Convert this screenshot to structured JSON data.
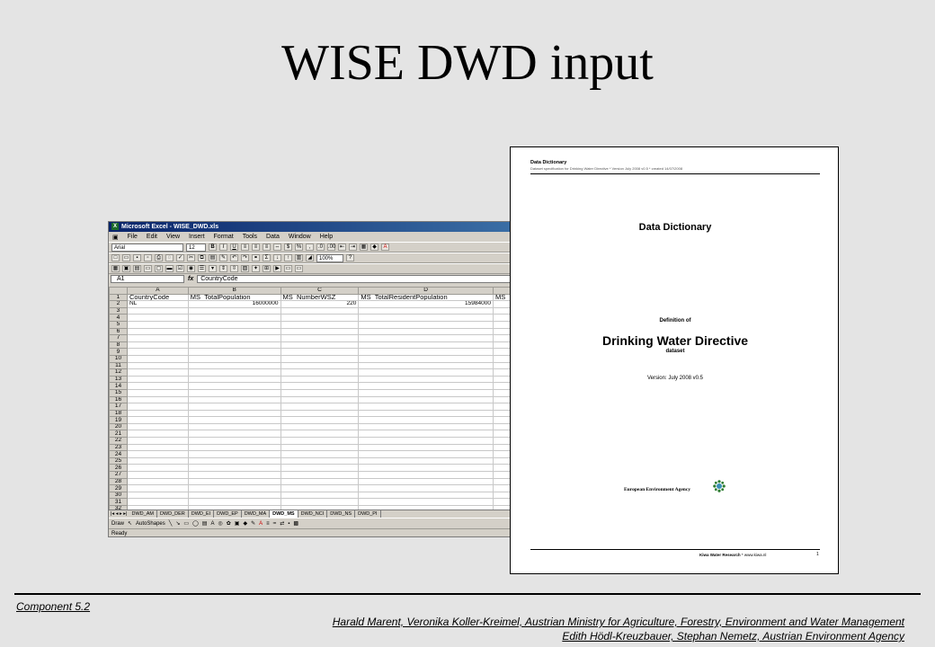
{
  "slide": {
    "title": "WISE DWD input",
    "component": "Component  5.2",
    "authors_line1": "Harald  Marent, Veronika Koller-Kreimel,  Austrian Ministry for Agriculture, Forestry, Environment and Water Management",
    "authors_line2": "Edith Hödl-Kreuzbauer,  Stephan Nemetz, Austrian Environment Agency"
  },
  "excel": {
    "title": "Microsoft Excel - WISE_DWD.xls",
    "menu": [
      "File",
      "Edit",
      "View",
      "Insert",
      "Format",
      "Tools",
      "Data",
      "Window",
      "Help"
    ],
    "font_name": "Arial",
    "font_size": "12",
    "zoom": "100%",
    "name_box": "A1",
    "formula_value": "CountryCode",
    "columns": [
      "A",
      "B",
      "C",
      "D"
    ],
    "header_row": [
      "CountryCode",
      "MS_TotalPopulation",
      "MS_NumberWSZ",
      "MS_TotalResidentPopulation",
      "MS_"
    ],
    "data_row": [
      "NL",
      "16000000",
      "220",
      "15984000"
    ],
    "row_count": 32,
    "tabs": [
      "DWD_AM",
      "DWD_DER",
      "DWD_EI",
      "DWD_EP",
      "DWD_MA",
      "DWD_MS",
      "DWD_NCI",
      "DWD_NS",
      "DWD_PI"
    ],
    "active_tab": "DWD_MS",
    "draw_label": "Draw",
    "autoshapes_label": "AutoShapes",
    "status": "Ready"
  },
  "doc": {
    "header_title": "Data Dictionary",
    "header_subtitle": "Dataset specification for Drinking Water Directive * Version July 2008 v0.5 * created 14/07/2008",
    "title": "Data Dictionary",
    "definition_of": "Definition of",
    "directive": "Drinking Water Directive",
    "dataset": "dataset",
    "version": "Version: July 2008 v0.5",
    "agency": "European Environment Agency",
    "footer_org": "Kiwa Water Research",
    "footer_url": "www.kiwa.nl",
    "page_number": "1"
  }
}
